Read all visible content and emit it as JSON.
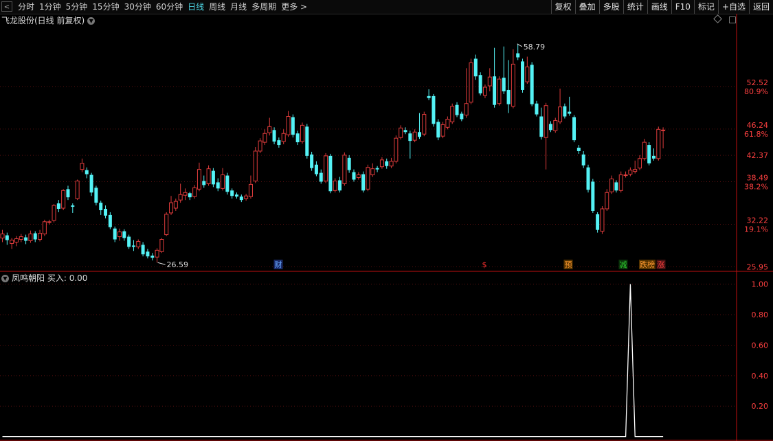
{
  "toolbar": {
    "back_glyph": "<",
    "periods": [
      {
        "label": "分时",
        "active": false
      },
      {
        "label": "1分钟",
        "active": false
      },
      {
        "label": "5分钟",
        "active": false
      },
      {
        "label": "15分钟",
        "active": false
      },
      {
        "label": "30分钟",
        "active": false
      },
      {
        "label": "60分钟",
        "active": false
      },
      {
        "label": "日线",
        "active": true
      },
      {
        "label": "周线",
        "active": false
      },
      {
        "label": "月线",
        "active": false
      },
      {
        "label": "多周期",
        "active": false
      },
      {
        "label": "更多 >",
        "active": false
      }
    ],
    "tools": [
      "复权",
      "叠加",
      "多股",
      "统计",
      "画线",
      "F10",
      "标记",
      "+自选",
      "返回"
    ]
  },
  "main_panel": {
    "title": "飞龙股份(日线 前复权)",
    "high_label": "58.79",
    "low_label": "26.59",
    "events": [
      {
        "label": "财",
        "color": "#6aa8ff",
        "bg": "#1a2a66",
        "x": 405
      },
      {
        "label": "$",
        "color": "#ff3030",
        "bg": "",
        "x": 705
      },
      {
        "label": "预",
        "color": "#ff9a30",
        "bg": "#553300",
        "x": 827
      },
      {
        "label": "减",
        "color": "#30d030",
        "bg": "#0a330a",
        "x": 907
      },
      {
        "label": "跌榜",
        "color": "#ff9a30",
        "bg": "#553300",
        "x": 942
      },
      {
        "label": "涨",
        "color": "#ff4040",
        "bg": "#441111",
        "x": 962
      }
    ]
  },
  "sub_panel": {
    "title": "凤鸣朝阳",
    "value_label": "买入: 0.00"
  },
  "colors": {
    "up": "#e03c3c",
    "down": "#54f2f5",
    "grid": "#5a1010",
    "axis": "#c01010",
    "label": "#ff4040",
    "sub_line": "#ffffff"
  },
  "chart_data": [
    {
      "type": "candlestick",
      "title": "飞龙股份(日线 前复权)",
      "y_ticks": [
        {
          "value": 52.52,
          "label": "52.52",
          "pct": "80.9%"
        },
        {
          "value": 46.24,
          "label": "46.24",
          "pct": "61.8%"
        },
        {
          "value": 42.37,
          "label": "42.37",
          "pct": ""
        },
        {
          "value": 38.49,
          "label": "38.49",
          "pct": "38.2%"
        },
        {
          "value": 32.22,
          "label": "32.22",
          "pct": "19.1%"
        },
        {
          "value": 25.95,
          "label": "25.95",
          "pct": ""
        }
      ],
      "ylim": [
        25.4,
        61.4
      ],
      "high": 58.79,
      "low": 26.59,
      "candles": [
        [
          30.2,
          30.8,
          29.6,
          31.4
        ],
        [
          30.6,
          29.9,
          29.2,
          31.0
        ],
        [
          29.4,
          29.9,
          28.6,
          30.2
        ],
        [
          29.6,
          30.1,
          29.0,
          30.5
        ],
        [
          30.0,
          30.4,
          29.6,
          30.8
        ],
        [
          30.3,
          29.8,
          29.3,
          30.7
        ],
        [
          29.8,
          30.8,
          29.5,
          31.3
        ],
        [
          30.9,
          30.0,
          29.6,
          31.2
        ],
        [
          30.0,
          30.9,
          29.7,
          31.4
        ],
        [
          30.8,
          32.6,
          30.5,
          32.9
        ],
        [
          32.5,
          32.6,
          32.2,
          32.9
        ],
        [
          32.8,
          35.0,
          32.5,
          35.2
        ],
        [
          35.3,
          34.5,
          34.0,
          35.8
        ],
        [
          34.6,
          37.2,
          34.3,
          37.4
        ],
        [
          37.4,
          36.2,
          35.8,
          37.9
        ],
        [
          35.0,
          34.8,
          33.9,
          35.3
        ],
        [
          36.0,
          38.6,
          35.8,
          38.8
        ],
        [
          40.3,
          41.2,
          39.9,
          41.9
        ],
        [
          40.2,
          39.6,
          39.0,
          40.6
        ],
        [
          39.5,
          36.9,
          36.4,
          39.8
        ],
        [
          37.6,
          35.4,
          35.0,
          37.9
        ],
        [
          35.4,
          34.3,
          33.6,
          35.7
        ],
        [
          34.5,
          33.5,
          33.1,
          35.0
        ],
        [
          33.6,
          31.8,
          31.5,
          34.0
        ],
        [
          31.6,
          30.0,
          29.6,
          31.9
        ],
        [
          30.4,
          31.1,
          29.8,
          31.6
        ],
        [
          31.2,
          30.2,
          29.8,
          31.5
        ],
        [
          30.4,
          28.9,
          28.6,
          30.7
        ],
        [
          29.1,
          28.9,
          28.3,
          29.9
        ],
        [
          28.9,
          29.7,
          28.6,
          30.0
        ],
        [
          29.2,
          27.8,
          27.5,
          29.6
        ],
        [
          28.2,
          27.5,
          27.2,
          28.6
        ],
        [
          27.6,
          27.3,
          26.9,
          28.0
        ],
        [
          27.4,
          28.4,
          26.59,
          28.7
        ],
        [
          28.2,
          30.0,
          28.0,
          30.2
        ],
        [
          30.7,
          33.7,
          30.5,
          34.0
        ],
        [
          33.9,
          35.4,
          33.6,
          36.4
        ],
        [
          34.6,
          35.6,
          34.2,
          36.0
        ],
        [
          35.8,
          36.6,
          35.4,
          38.2
        ],
        [
          36.5,
          36.9,
          35.8,
          37.5
        ],
        [
          36.8,
          36.2,
          35.8,
          37.0
        ],
        [
          36.3,
          37.6,
          36.0,
          38.0
        ],
        [
          37.4,
          40.3,
          37.1,
          41.3
        ],
        [
          38.6,
          38.0,
          37.6,
          39.4
        ],
        [
          38.2,
          40.4,
          37.9,
          40.9
        ],
        [
          40.1,
          38.1,
          37.7,
          40.5
        ],
        [
          38.4,
          37.5,
          37.1,
          39.0
        ],
        [
          37.5,
          39.5,
          37.2,
          40.5
        ],
        [
          39.4,
          37.0,
          36.6,
          39.8
        ],
        [
          37.2,
          36.4,
          36.0,
          37.5
        ],
        [
          36.6,
          36.3,
          36.0,
          36.9
        ],
        [
          36.3,
          35.8,
          35.5,
          36.6
        ],
        [
          36.0,
          36.4,
          35.7,
          36.7
        ],
        [
          36.3,
          38.1,
          36.0,
          39.4
        ],
        [
          38.6,
          43.0,
          38.3,
          43.6
        ],
        [
          43.0,
          44.5,
          42.7,
          44.9
        ],
        [
          44.3,
          45.6,
          43.9,
          46.2
        ],
        [
          45.7,
          46.6,
          45.3,
          47.9
        ],
        [
          46.1,
          44.4,
          44.0,
          46.5
        ],
        [
          44.6,
          43.9,
          43.5,
          45.0
        ],
        [
          44.4,
          45.6,
          44.0,
          46.2
        ],
        [
          45.4,
          48.1,
          45.1,
          48.9
        ],
        [
          48.0,
          45.4,
          45.0,
          48.4
        ],
        [
          45.6,
          44.3,
          43.9,
          46.0
        ],
        [
          44.4,
          46.8,
          44.1,
          47.2
        ],
        [
          46.6,
          42.3,
          41.9,
          47.0
        ],
        [
          42.5,
          40.5,
          40.1,
          42.9
        ],
        [
          41.0,
          39.6,
          39.3,
          41.5
        ],
        [
          39.8,
          38.5,
          38.2,
          40.3
        ],
        [
          38.6,
          42.3,
          38.3,
          42.7
        ],
        [
          42.3,
          37.1,
          36.8,
          42.6
        ],
        [
          37.2,
          38.6,
          36.9,
          39.0
        ],
        [
          38.7,
          37.2,
          36.9,
          39.2
        ],
        [
          38.2,
          42.4,
          37.9,
          42.8
        ],
        [
          42.0,
          40.2,
          39.8,
          42.4
        ],
        [
          39.9,
          38.8,
          38.5,
          40.3
        ],
        [
          39.1,
          39.5,
          38.8,
          39.9
        ],
        [
          39.6,
          37.2,
          36.9,
          40.0
        ],
        [
          37.4,
          40.6,
          37.1,
          41.0
        ],
        [
          39.5,
          40.4,
          39.2,
          41.2
        ],
        [
          40.5,
          40.3,
          39.9,
          40.8
        ],
        [
          40.7,
          41.7,
          40.4,
          42.1
        ],
        [
          41.5,
          40.8,
          40.4,
          41.9
        ],
        [
          40.8,
          41.5,
          40.5,
          42.0
        ],
        [
          41.5,
          44.9,
          41.2,
          45.3
        ],
        [
          45.0,
          46.4,
          44.7,
          46.8
        ],
        [
          46.1,
          45.8,
          45.5,
          46.5
        ],
        [
          45.6,
          44.5,
          41.9,
          46.0
        ],
        [
          44.6,
          45.8,
          44.3,
          46.2
        ],
        [
          45.8,
          45.1,
          44.8,
          48.6
        ],
        [
          45.5,
          48.4,
          45.2,
          48.8
        ],
        [
          51.1,
          50.8,
          50.5,
          52.1
        ],
        [
          51.1,
          47.0,
          46.6,
          51.4
        ],
        [
          47.3,
          45.0,
          44.6,
          47.7
        ],
        [
          45.2,
          46.9,
          44.9,
          47.3
        ],
        [
          46.5,
          47.7,
          46.2,
          48.1
        ],
        [
          47.3,
          49.6,
          47.0,
          50.0
        ],
        [
          49.8,
          48.3,
          48.0,
          50.2
        ],
        [
          48.5,
          47.7,
          47.4,
          48.8
        ],
        [
          48.3,
          50.0,
          47.9,
          55.2
        ],
        [
          50.2,
          56.0,
          49.9,
          56.6
        ],
        [
          56.6,
          54.0,
          53.5,
          57.2
        ],
        [
          54.2,
          51.5,
          51.2,
          54.6
        ],
        [
          51.2,
          52.4,
          50.8,
          52.8
        ],
        [
          52.6,
          53.9,
          51.8,
          55.2
        ],
        [
          54.0,
          49.8,
          49.4,
          58.2
        ],
        [
          50.0,
          53.6,
          49.7,
          54.0
        ],
        [
          53.8,
          51.8,
          51.4,
          58.4
        ],
        [
          52.0,
          49.9,
          48.6,
          56.4
        ],
        [
          49.6,
          55.8,
          49.3,
          58.0
        ],
        [
          57.4,
          56.8,
          56.4,
          58.79
        ],
        [
          56.2,
          52.0,
          51.6,
          56.6
        ],
        [
          53.2,
          55.4,
          52.9,
          56.9
        ],
        [
          55.7,
          49.9,
          49.6,
          56.1
        ],
        [
          50.0,
          48.4,
          48.1,
          50.4
        ],
        [
          48.1,
          45.1,
          44.7,
          49.4
        ],
        [
          45.0,
          49.7,
          40.3,
          50.1
        ],
        [
          47.0,
          46.1,
          45.8,
          47.4
        ],
        [
          46.0,
          47.5,
          45.7,
          47.9
        ],
        [
          47.3,
          49.5,
          47.0,
          52.2
        ],
        [
          49.6,
          48.1,
          47.8,
          50.0
        ],
        [
          48.8,
          48.5,
          48.2,
          51.0
        ],
        [
          48.0,
          44.6,
          44.3,
          48.3
        ],
        [
          43.5,
          43.0,
          42.6,
          43.9
        ],
        [
          42.5,
          40.9,
          40.5,
          43.0
        ],
        [
          40.6,
          37.3,
          36.9,
          41.0
        ],
        [
          38.5,
          34.2,
          33.9,
          38.9
        ],
        [
          33.7,
          31.4,
          31.0,
          34.0
        ],
        [
          31.2,
          34.5,
          30.8,
          34.9
        ],
        [
          34.5,
          36.9,
          34.2,
          37.4
        ],
        [
          37.0,
          38.9,
          36.7,
          39.4
        ],
        [
          38.4,
          37.2,
          36.9,
          38.7
        ],
        [
          37.2,
          39.5,
          36.9,
          40.0
        ],
        [
          39.4,
          39.5,
          39.1,
          40.0
        ],
        [
          39.6,
          40.2,
          39.3,
          40.6
        ],
        [
          40.0,
          40.3,
          39.7,
          41.6
        ],
        [
          40.5,
          41.9,
          40.2,
          42.4
        ],
        [
          41.9,
          44.3,
          41.6,
          44.8
        ],
        [
          43.9,
          41.2,
          40.9,
          44.3
        ],
        [
          42.3,
          41.9,
          41.6,
          43.4
        ],
        [
          41.9,
          46.2,
          41.6,
          46.6
        ],
        [
          46.0,
          46.1,
          43.4,
          46.5
        ]
      ]
    },
    {
      "type": "line",
      "title": "凤鸣朝阳",
      "series_name": "买入",
      "y_ticks": [
        {
          "value": 1.0,
          "label": "1.00"
        },
        {
          "value": 0.8,
          "label": "0.80"
        },
        {
          "value": 0.6,
          "label": "0.60"
        },
        {
          "value": 0.4,
          "label": "0.40"
        },
        {
          "value": 0.2,
          "label": "0.20"
        }
      ],
      "ylim": [
        -0.02,
        1.08
      ],
      "spike_index": 134,
      "spike_value": 1.0
    }
  ]
}
